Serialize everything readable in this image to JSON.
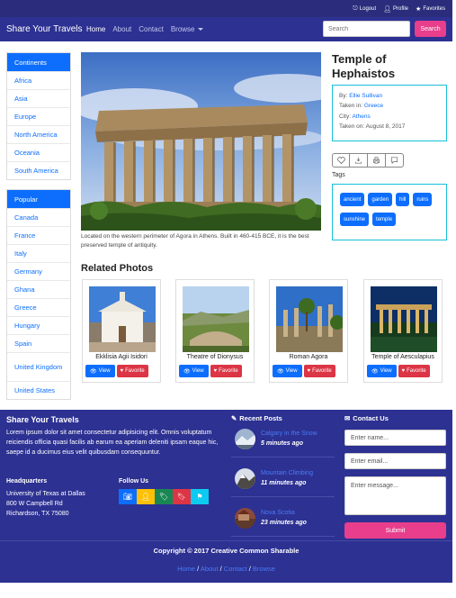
{
  "topbar": {
    "logout": "Logout",
    "profile": "Profile",
    "favorites": "Favorites"
  },
  "navbar": {
    "brand": "Share Your Travels",
    "links": [
      "Home",
      "About",
      "Contact",
      "Browse"
    ],
    "search_placeholder": "Search",
    "search_button": "Search"
  },
  "sidebar": {
    "continents_title": "Continents",
    "continents": [
      "Africa",
      "Asia",
      "Europe",
      "North America",
      "Oceania",
      "South America"
    ],
    "popular_title": "Popular",
    "popular": [
      "Canada",
      "France",
      "Italy",
      "Germany",
      "Ghana",
      "Greece",
      "Hungary",
      "Spain",
      "United Kingdom",
      "United States"
    ]
  },
  "photo": {
    "title": "Temple of Hephaistos",
    "caption": "Located on the western perimeter of Agora in Athens. Built in 460-415 BCE, it is the best preserved temple of antiquity.",
    "by_label": "By:",
    "by_value": "Ellie Sullivan",
    "taken_in_label": "Taken in:",
    "taken_in_value": "Greece",
    "city_label": "City:",
    "city_value": "Athens",
    "taken_on_label": "Taken on:",
    "taken_on_value": "August 8, 2017"
  },
  "actions": [
    "heart-icon",
    "download-icon",
    "print-icon",
    "comment-icon"
  ],
  "tags_label": "Tags",
  "tags": [
    "ancient",
    "garden",
    "hill",
    "ruins",
    "sunshine",
    "temple"
  ],
  "related": {
    "title": "Related Photos",
    "view_label": "View",
    "favorite_label": "Favorite",
    "items": [
      "Ekklisia Agii Isidori",
      "Theatre of Dionysus",
      "Roman Agora",
      "Temple of Aesculapius"
    ]
  },
  "footer": {
    "brand": "Share Your Travels",
    "lorem": "Lorem ipsum dolor sit amet consectetur adipisicing elit. Omnis voluptatum reiciendis officia quasi facilis ab earum ea aperiam deleniti ipsam eaque hic, saepe id a ducimus eius velit quibusdam consequuntur.",
    "hq_title": "Headquarters",
    "hq_line1": "University of Texas at Dallas",
    "hq_line2": "800 W Campbell Rd",
    "hq_line3": "Richardson, TX 75080",
    "follow_title": "Follow Us",
    "social_colors": [
      "#0d6efd",
      "#ffc107",
      "#198754",
      "#dc3545",
      "#0dcaf0"
    ],
    "recent_title": "Recent Posts",
    "posts": [
      {
        "title": "Calgary in the Snow",
        "time": "5 minutes ago"
      },
      {
        "title": "Mountain Climbing",
        "time": "11 minutes ago"
      },
      {
        "title": "Nova Scotia",
        "time": "23 minutes ago"
      }
    ],
    "contact_title": "Contact Us",
    "name_placeholder": "Enter name...",
    "email_placeholder": "Enter email...",
    "message_placeholder": "Enter message...",
    "submit": "Submit",
    "copyright": "Copyright © 2017 Creative Common Sharable",
    "links": [
      "Home",
      "About",
      "Contact",
      "Browse"
    ]
  }
}
